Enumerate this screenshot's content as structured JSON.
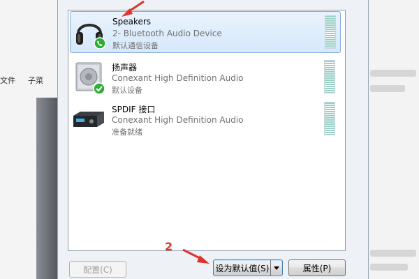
{
  "background": {
    "left_text": "文件 　 子菜"
  },
  "devices": [
    {
      "name": "Speakers",
      "description": "2- Bluetooth Audio Device",
      "status": "默认通信设备",
      "icon": "headphones-icon",
      "badge": "phone-check-badge-icon",
      "selected": true
    },
    {
      "name": "扬声器",
      "description": "Conexant High Definition Audio",
      "status": "默认设备",
      "icon": "speaker-icon",
      "badge": "green-check-badge-icon",
      "selected": false
    },
    {
      "name": "SPDIF 接口",
      "description": "Conexant High Definition Audio",
      "status": "准备就绪",
      "icon": "receiver-icon",
      "badge": "",
      "selected": false
    }
  ],
  "buttons": {
    "configure": "配置(C)",
    "set_default": "设为默认值(S)",
    "properties": "属性(P)"
  },
  "annotations": {
    "step2": "2"
  },
  "colors": {
    "selection": "#d6e8fb",
    "meter": "#9cd0c7",
    "annotation": "#e0322a",
    "check_green": "#2eae37"
  }
}
